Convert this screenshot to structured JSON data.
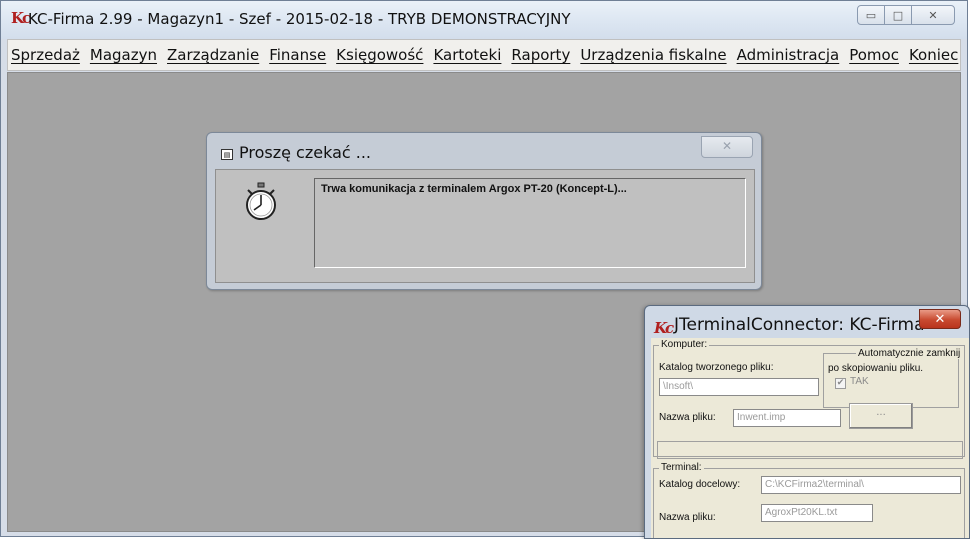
{
  "main": {
    "title": "KC-Firma 2.99 - Magazyn1 - Szef - 2015-02-18 - TRYB DEMONSTRACYJNY",
    "app_icon": "Kc",
    "window_controls": {
      "minimize": "▭",
      "maximize": "□",
      "close": "✕"
    },
    "menu": [
      {
        "label": "Sprzedaż"
      },
      {
        "label": "Magazyn"
      },
      {
        "label": "Zarządzanie"
      },
      {
        "label": "Finanse"
      },
      {
        "label": "Księgowość"
      },
      {
        "label": "Kartoteki"
      },
      {
        "label": "Raporty"
      },
      {
        "label": "Urządzenia fiskalne"
      },
      {
        "label": "Administracja"
      },
      {
        "label": "Pomoc"
      },
      {
        "label": "Koniec"
      }
    ]
  },
  "wait_dialog": {
    "title": "Proszę czekać ...",
    "close": "✕",
    "message": "Trwa komunikacja z terminalem Argox PT-20 (Koncept-L)...",
    "icon": "stopwatch-icon"
  },
  "connector": {
    "title": "JTerminalConnector: KC-Firma",
    "logo": "Kc",
    "close": "✕",
    "komputer_legend": "Komputer:",
    "katalog_label": "Katalog tworzonego pliku:",
    "katalog_value": "\\Insoft\\",
    "auto_close_legend": "Automatycznie zamknij",
    "auto_close_legend2": "po skopiowaniu pliku.",
    "tak_label": "TAK",
    "tak_checked": true,
    "nazwa_label": "Nazwa pliku:",
    "nazwa_value": "Inwent.imp",
    "browse_label": "...",
    "terminal_legend": "Terminal:",
    "katalog_docelowy_label": "Katalog docelowy:",
    "katalog_docelowy_value": "C:\\KCFirma2\\terminal\\",
    "terminal_nazwa_label": "Nazwa pliku:",
    "terminal_nazwa_value": "AgroxPt20KL.txt"
  }
}
